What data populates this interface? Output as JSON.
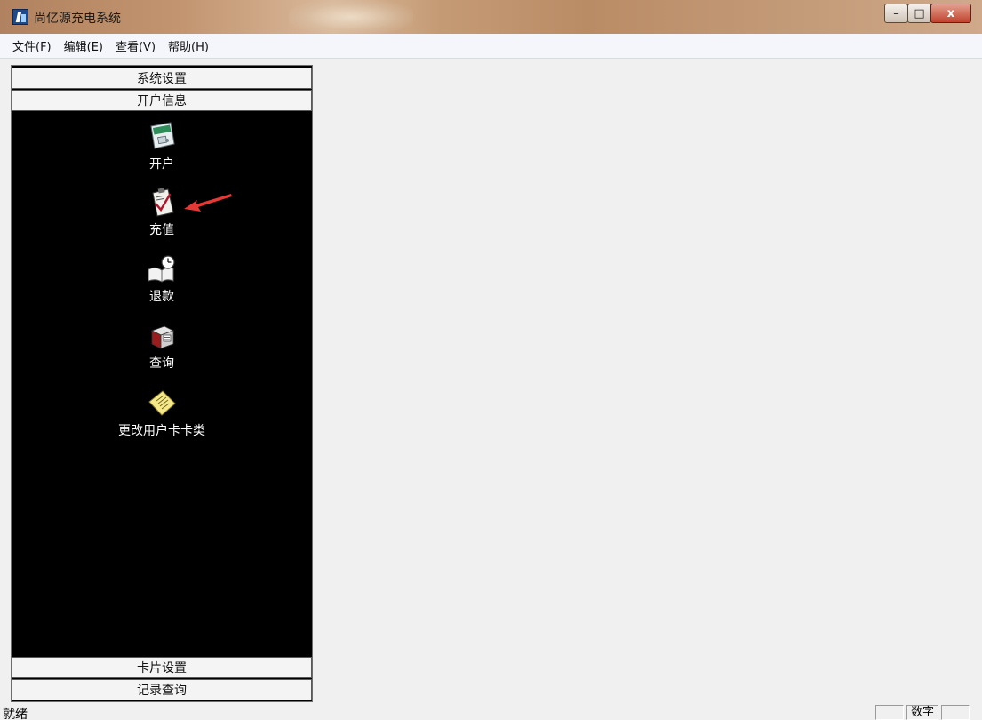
{
  "window": {
    "title": "尚亿源充电系统",
    "controls": {
      "minimize": "–",
      "maximize": "□",
      "close": "x"
    }
  },
  "menu": [
    {
      "label": "文件(F)"
    },
    {
      "label": "编辑(E)"
    },
    {
      "label": "查看(V)"
    },
    {
      "label": "帮助(H)"
    }
  ],
  "sidebar": {
    "groups": [
      {
        "label": "系统设置"
      },
      {
        "label": "开户信息"
      },
      {
        "label": "卡片设置"
      },
      {
        "label": "记录查询"
      }
    ],
    "items": [
      {
        "label": "开户",
        "icon": "open-account-icon"
      },
      {
        "label": "充值",
        "icon": "recharge-clipboard-icon"
      },
      {
        "label": "退款",
        "icon": "refund-book-clock-icon"
      },
      {
        "label": "查询",
        "icon": "query-box-icon"
      },
      {
        "label": "更改用户卡卡类",
        "icon": "change-card-note-icon"
      }
    ]
  },
  "annotation": {
    "color": "#e53935"
  },
  "status": {
    "text": "就绪",
    "panes": [
      "",
      "数字",
      ""
    ]
  }
}
